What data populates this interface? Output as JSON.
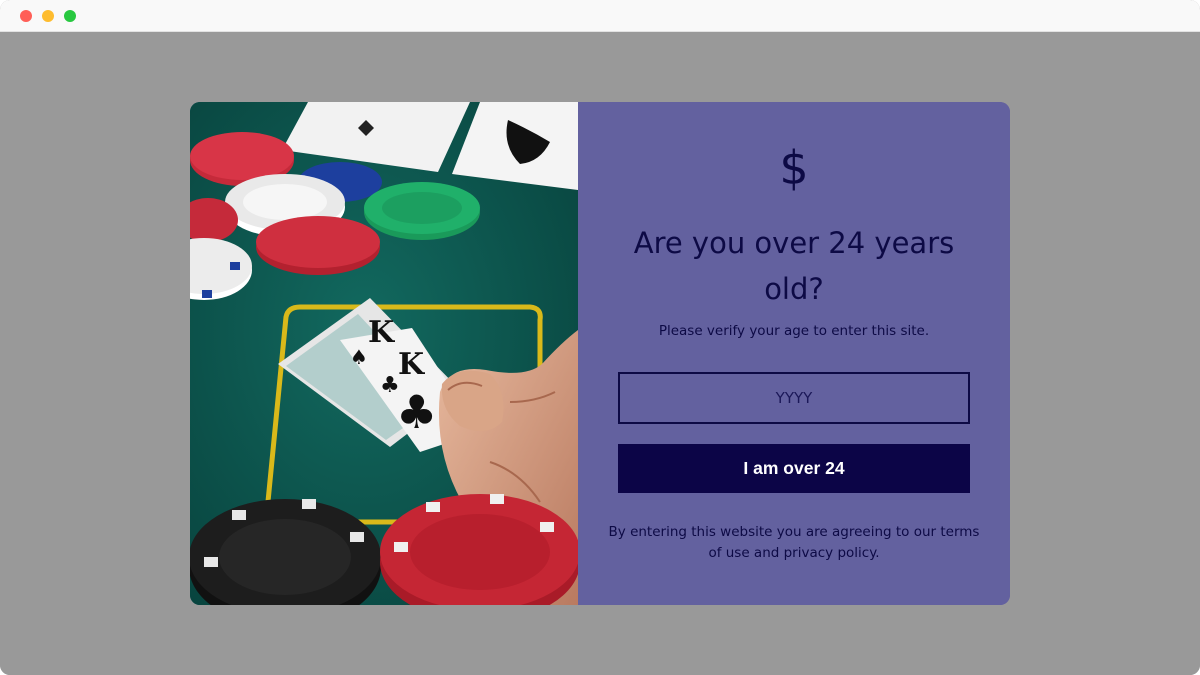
{
  "age_gate": {
    "icon": "dollar-sign-icon",
    "icon_glyph": "$",
    "headline": "Are you over 24 years old?",
    "subtext": "Please verify your age to enter this site.",
    "year_input": {
      "placeholder": "YYYY",
      "value": ""
    },
    "submit_label": "I am over 24",
    "legal_text": "By entering this website you are agreeing to our terms of use and privacy policy."
  },
  "image": {
    "subject": "poker-table-hand-lifting-two-kings-with-chips"
  },
  "colors": {
    "backdrop": "#999999",
    "panel": "#63619f",
    "text": "#0d0a45",
    "button": "#0c0547",
    "button_text": "#ffffff",
    "felt": "#0d5a52"
  }
}
